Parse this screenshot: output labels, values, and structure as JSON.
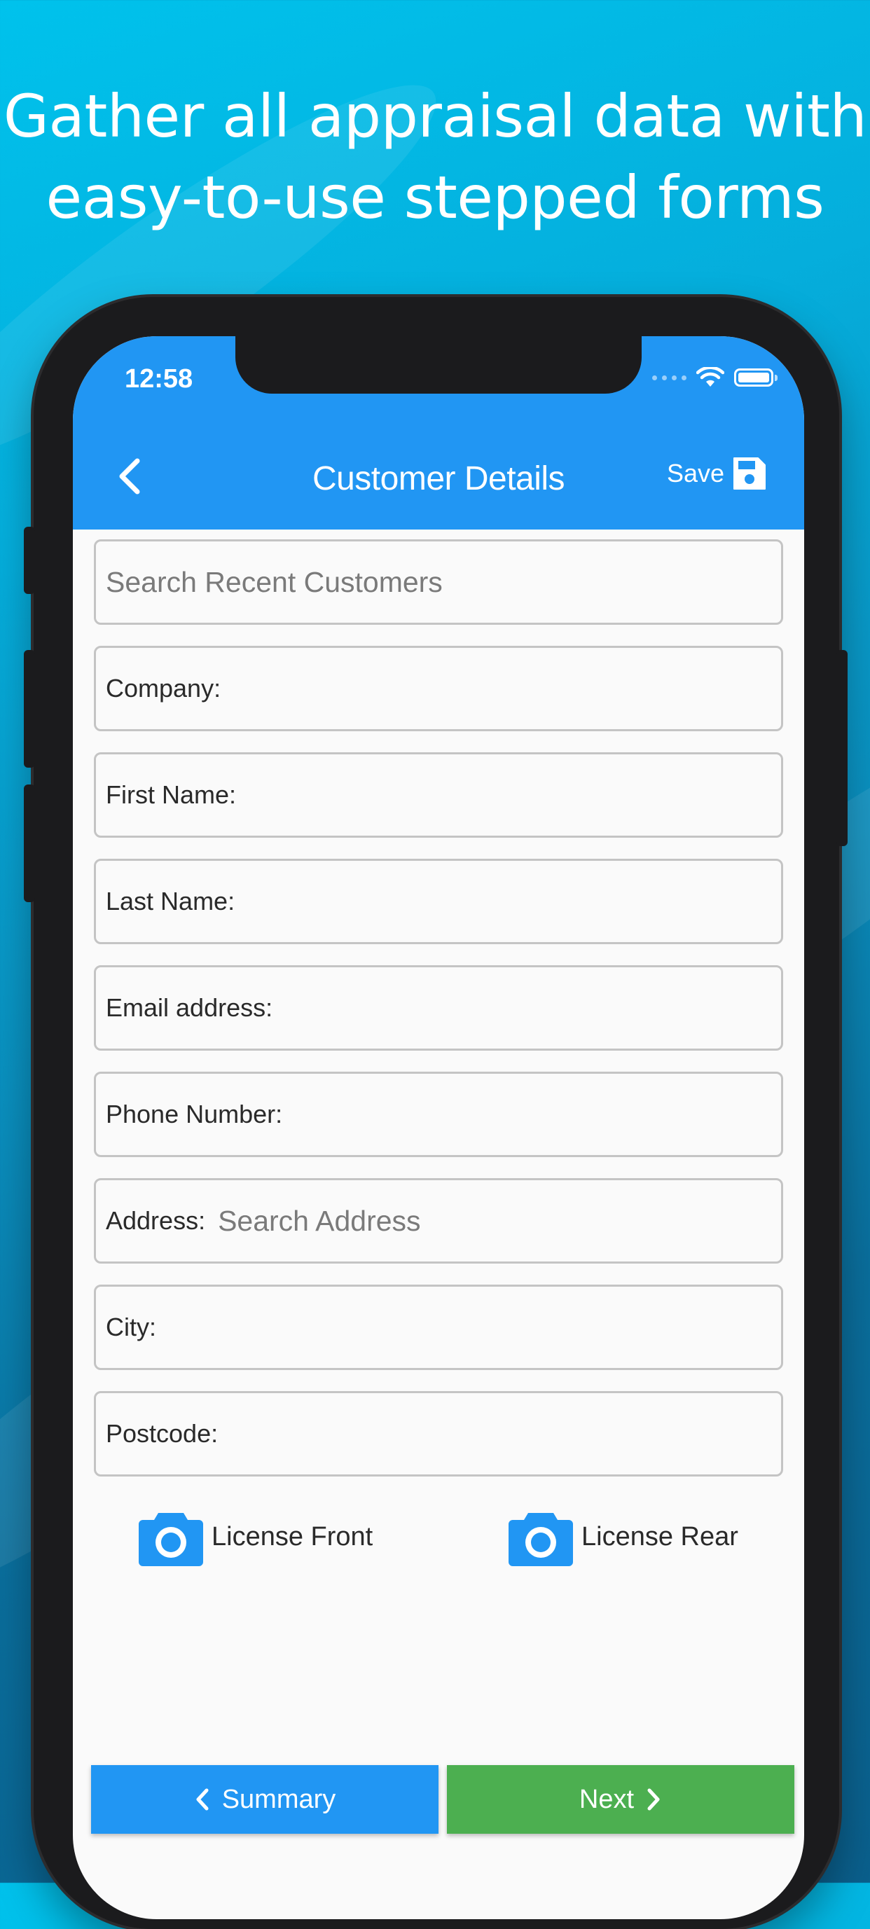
{
  "headline": {
    "line1": "Gather all appraisal data with",
    "line2": "easy-to-use stepped forms"
  },
  "status_bar": {
    "time": "12:58"
  },
  "app_bar": {
    "title": "Customer Details",
    "save_label": "Save"
  },
  "form": {
    "search_placeholder": "Search Recent Customers",
    "company_label": "Company:",
    "first_name_label": "First Name:",
    "last_name_label": "Last Name:",
    "email_label": "Email address:",
    "phone_label": "Phone Number:",
    "address_label": "Address:",
    "address_placeholder": "Search Address",
    "city_label": "City:",
    "postcode_label": "Postcode:"
  },
  "license": {
    "front_label": "License Front",
    "rear_label": "License Rear"
  },
  "nav": {
    "prev_label": "Summary",
    "next_label": "Next"
  },
  "colors": {
    "primary": "#2196f3",
    "next": "#4caf50",
    "background_top": "#00c2ec",
    "background_bottom": "#0a5f8c"
  }
}
